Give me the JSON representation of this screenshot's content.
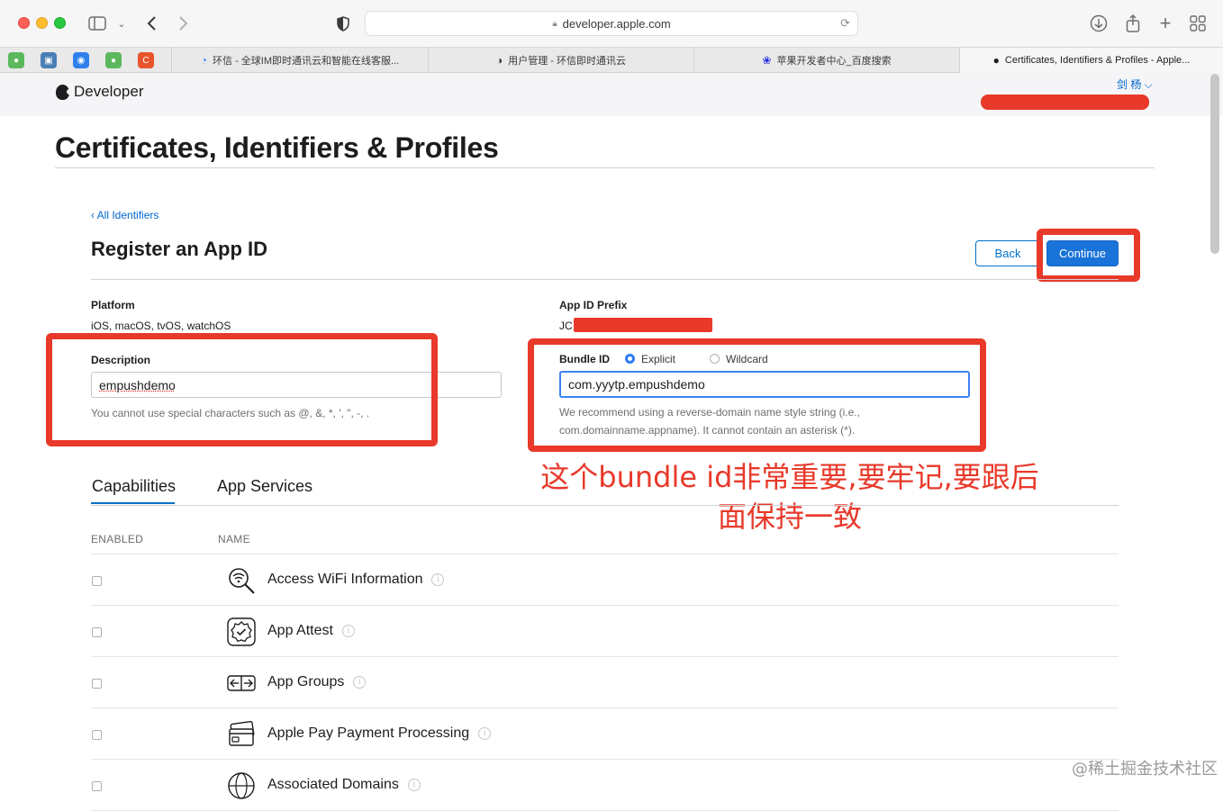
{
  "browser": {
    "url": "developer.apple.com",
    "tabs": [
      {
        "title": "环信 - 全球IM即时通讯云和智能在线客服..."
      },
      {
        "title": "用户管理 - 环信即时通讯云"
      },
      {
        "title": "苹果开发者中心_百度搜索"
      },
      {
        "title": "Certificates, Identifiers & Profiles - Apple..."
      }
    ],
    "favorites": [
      {
        "icon": "green-circle-icon",
        "color": "#5cb85c"
      },
      {
        "icon": "folder-icon",
        "color": "#4a7fb5"
      },
      {
        "icon": "badge-icon",
        "color": "#2f80ed"
      },
      {
        "icon": "green-circle-icon",
        "color": "#5cb85c"
      },
      {
        "label": "C",
        "icon": "c-logo-icon",
        "color": "#e8552d"
      }
    ]
  },
  "site": {
    "brand": "Developer",
    "user": "剑 杨 ⌵"
  },
  "page": {
    "title": "Certificates, Identifiers & Profiles",
    "back_link": "‹ All Identifiers",
    "section_title": "Register an App ID",
    "back_button": "Back",
    "continue_button": "Continue"
  },
  "form": {
    "platform_label": "Platform",
    "platform_value": "iOS, macOS, tvOS, watchOS",
    "prefix_label": "App ID Prefix",
    "prefix_value": "JC",
    "description_label": "Description",
    "description_value": "empushdemo",
    "description_hint": "You cannot use special characters such as @, &, *, ', \", -, .",
    "bundle_label": "Bundle ID",
    "bundle_options": [
      {
        "label": "Explicit",
        "selected": true
      },
      {
        "label": "Wildcard",
        "selected": false
      }
    ],
    "bundle_value": "com.yyytp.empushdemo",
    "bundle_hint_line1": "We recommend using a reverse-domain name style string (i.e.,",
    "bundle_hint_line2": "com.domainname.appname). It cannot contain an asterisk (*)."
  },
  "annotation": {
    "line1": "这个bundle id非常重要,要牢记,要跟后",
    "line2": "面保持一致",
    "color": "#e8392a"
  },
  "capabilities": {
    "tabs": [
      {
        "label": "Capabilities",
        "active": true
      },
      {
        "label": "App Services",
        "active": false
      }
    ],
    "col_enabled": "ENABLED",
    "col_name": "NAME",
    "items": [
      {
        "name": "Access WiFi Information",
        "icon": "wifi-search-icon",
        "enabled": false
      },
      {
        "name": "App Attest",
        "icon": "badge-check-icon",
        "enabled": false
      },
      {
        "name": "App Groups",
        "icon": "app-groups-icon",
        "enabled": false
      },
      {
        "name": "Apple Pay Payment Processing",
        "icon": "apple-pay-icon",
        "enabled": false
      },
      {
        "name": "Associated Domains",
        "icon": "globe-icon",
        "enabled": false
      }
    ]
  },
  "watermark": "@稀土掘金技术社区"
}
